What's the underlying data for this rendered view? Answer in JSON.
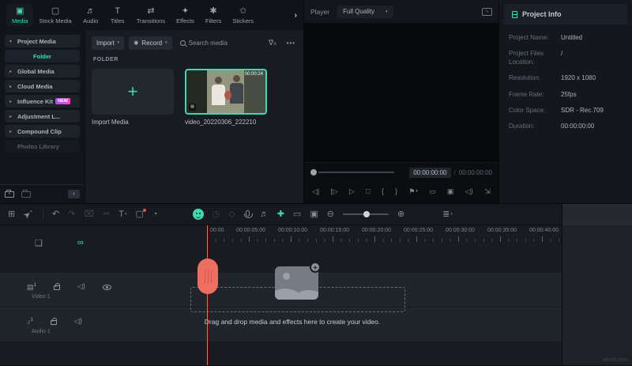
{
  "colors": {
    "accent": "#3fd9ad",
    "playhead": "#f0685c",
    "badge_from": "#a44ff0",
    "badge_to": "#ef4fc8"
  },
  "tabbar": {
    "tabs": [
      {
        "name": "media",
        "label": "Media",
        "icon": "image-icon",
        "glyph": "▣",
        "active": true
      },
      {
        "name": "stock-media",
        "label": "Stock Media",
        "icon": "box-icon",
        "glyph": "▢"
      },
      {
        "name": "audio",
        "label": "Audio",
        "icon": "music-icon",
        "glyph": "♬"
      },
      {
        "name": "titles",
        "label": "Titles",
        "icon": "text-icon",
        "glyph": "T"
      },
      {
        "name": "transitions",
        "label": "Transitions",
        "icon": "arrows-icon",
        "glyph": "⇄"
      },
      {
        "name": "effects",
        "label": "Effects",
        "icon": "star-icon",
        "glyph": "✦"
      },
      {
        "name": "filters",
        "label": "Filters",
        "icon": "sparkle-icon",
        "glyph": "✱"
      },
      {
        "name": "stickers",
        "label": "Stickers",
        "icon": "sticker-icon",
        "glyph": "✩"
      }
    ],
    "more_glyph": "›"
  },
  "sidebar": {
    "items": [
      {
        "label": "Project Media",
        "caret": "▾"
      },
      {
        "label": "Folder",
        "selected": true
      },
      {
        "label": "Global Media",
        "caret": "▸"
      },
      {
        "label": "Cloud Media",
        "caret": "▸"
      },
      {
        "label": "Influence Kit",
        "caret": "▸",
        "badge": "NEW"
      },
      {
        "label": "Adjustment L...",
        "caret": "▸"
      },
      {
        "label": "Compound Clip",
        "caret": "▸"
      },
      {
        "label": "Photos Library",
        "dim": true
      }
    ],
    "collapse_glyph": "‹"
  },
  "media": {
    "import_button": "Import",
    "record_button": "Record",
    "search_placeholder": "Search media",
    "section_label": "FOLDER",
    "import_card_label": "Import Media",
    "video_name": "video_20220306_222210",
    "video_duration": "00:00:24",
    "more_glyph": "•••"
  },
  "player": {
    "label": "Player",
    "quality": "Full Quality",
    "current_time": "00:00:00:00",
    "separator": "/",
    "total_time": "00:00:00:00",
    "transport": [
      {
        "name": "previous-frame-icon",
        "glyph": "◁|"
      },
      {
        "name": "next-frame-icon",
        "glyph": "|▷"
      },
      {
        "name": "play-icon",
        "glyph": "▷"
      },
      {
        "name": "stop-icon",
        "glyph": "□"
      },
      {
        "name": "mark-in-icon",
        "glyph": "{"
      },
      {
        "name": "mark-out-icon",
        "glyph": "}"
      },
      {
        "name": "marker-icon",
        "glyph": "⚑",
        "chevron": true
      },
      {
        "name": "fit-screen-icon",
        "glyph": "▭"
      },
      {
        "name": "snapshot-icon",
        "glyph": "▣"
      },
      {
        "name": "volume-icon",
        "glyph": "◁⟩"
      },
      {
        "name": "fullscreen-icon",
        "glyph": "⇲"
      }
    ]
  },
  "project_info": {
    "title": "Project Info",
    "rows": [
      {
        "label": "Project Name:",
        "value": "Untitled"
      },
      {
        "label": "Project Files Location:",
        "value": "/"
      },
      {
        "label": "Resolution:",
        "value": "1920 x 1080"
      },
      {
        "label": "Frame Rate:",
        "value": "25fps"
      },
      {
        "label": "Color Space:",
        "value": "SDR - Rec.709"
      },
      {
        "label": "Duration:",
        "value": "00:00:00:00"
      }
    ]
  },
  "timeline": {
    "toolbar": [
      {
        "name": "workspace-grid-icon",
        "glyph": "⊞"
      },
      {
        "name": "select-tool-icon",
        "glyph": "➤",
        "rot": -40,
        "chevron": true
      },
      {
        "type": "divider"
      },
      {
        "name": "undo-icon",
        "glyph": "↶"
      },
      {
        "name": "redo-icon",
        "glyph": "↷",
        "dim": true
      },
      {
        "name": "delete-icon",
        "glyph": "⌧",
        "dim": true
      },
      {
        "name": "split-icon",
        "glyph": "✂",
        "dim": true
      },
      {
        "name": "text-tool-icon",
        "glyph": "T",
        "chevron": true
      },
      {
        "name": "crop-icon",
        "glyph": "▢",
        "dot": true
      },
      {
        "name": "color-palette-icon",
        "glyph": "◔"
      },
      {
        "type": "gap",
        "w": 22
      },
      {
        "name": "smart-cutout-icon",
        "special": "teal-circle"
      },
      {
        "name": "speed-icon",
        "glyph": "◷",
        "dim": true
      },
      {
        "name": "mask-icon",
        "glyph": "◇",
        "dim": true
      },
      {
        "name": "voiceover-mic-icon",
        "special": "mic"
      },
      {
        "name": "audio-mixer-icon",
        "glyph": "♬"
      },
      {
        "name": "motion-tracking-icon",
        "glyph": "✚",
        "teal": true
      },
      {
        "name": "screen-record-icon",
        "glyph": "▭"
      },
      {
        "name": "render-preview-icon",
        "glyph": "▣"
      },
      {
        "name": "zoom-out-icon",
        "glyph": "⊖"
      },
      {
        "type": "slider"
      },
      {
        "name": "zoom-in-icon",
        "glyph": "⊕"
      },
      {
        "type": "gap",
        "w": 26
      },
      {
        "name": "track-manager-icon",
        "glyph": "≣",
        "chevron": true
      }
    ],
    "ruler_labels": [
      "00:00",
      "00:00:05:00",
      "00:00:10:00",
      "00:00:15:00",
      "00:00:20:00",
      "00:00:25:00",
      "00:00:30:00",
      "00:00:35:00",
      "00:00:40:00"
    ],
    "tracks": [
      {
        "label": "Video 1"
      },
      {
        "label": "Audio 1"
      }
    ],
    "drop_hint": "Drag and drop media and effects here to create your video."
  },
  "watermark": "winxit.com"
}
